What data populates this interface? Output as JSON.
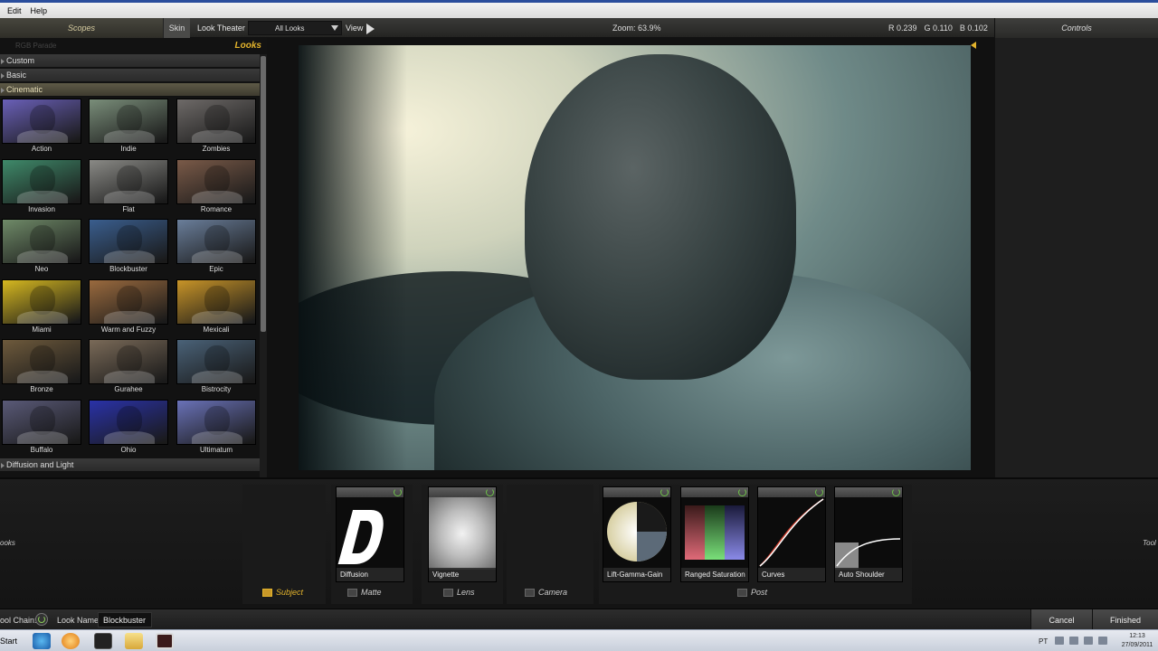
{
  "menu": {
    "edit": "Edit",
    "help": "Help"
  },
  "topbar": {
    "scopes": "Scopes",
    "skin": "Skin",
    "look_theater": "Look Theater",
    "look_filter": "All Looks",
    "view": "View",
    "zoom": "Zoom:  63.9%",
    "r": "R 0.239",
    "g": "G 0.110",
    "b": "B 0.102",
    "controls": "Controls"
  },
  "looks_panel": {
    "ghost_label": "RGB Parade",
    "title": "Looks",
    "categories": [
      "Custom",
      "Basic",
      "Cinematic"
    ],
    "bottom_category": "Diffusion and Light",
    "thumbnails": [
      {
        "label": "Action",
        "tint": "#6a60b8"
      },
      {
        "label": "Indie",
        "tint": "#7a8e7a"
      },
      {
        "label": "Zombies",
        "tint": "#6e6a68"
      },
      {
        "label": "Invasion",
        "tint": "#3f8a6a"
      },
      {
        "label": "Flat",
        "tint": "#8a8a86"
      },
      {
        "label": "Romance",
        "tint": "#7a5a48"
      },
      {
        "label": "Neo",
        "tint": "#6f8a68"
      },
      {
        "label": "Blockbuster",
        "tint": "#3a5e8e"
      },
      {
        "label": "Epic",
        "tint": "#6a7e9a"
      },
      {
        "label": "Miami",
        "tint": "#d6b820"
      },
      {
        "label": "Warm and Fuzzy",
        "tint": "#9a6a3e"
      },
      {
        "label": "Mexicali",
        "tint": "#c89428"
      },
      {
        "label": "Bronze",
        "tint": "#6e5a3c"
      },
      {
        "label": "Gurahee",
        "tint": "#7a6a58"
      },
      {
        "label": "Bistrocity",
        "tint": "#4a6278"
      },
      {
        "label": "Buffalo",
        "tint": "#5a5a78"
      },
      {
        "label": "Ohio",
        "tint": "#2a32a8"
      },
      {
        "label": "Ultimatum",
        "tint": "#6a72b8"
      }
    ]
  },
  "tools": {
    "side_left": "ooks",
    "side_right": "Tool",
    "items": [
      {
        "name": "Diffusion"
      },
      {
        "name": "Vignette"
      },
      {
        "name": "Lift-Gamma-Gain"
      },
      {
        "name": "Ranged Saturation"
      },
      {
        "name": "Curves"
      },
      {
        "name": "Auto Shoulder"
      }
    ],
    "sections": [
      "Subject",
      "Matte",
      "Lens",
      "Camera",
      "Post"
    ]
  },
  "footer": {
    "tool_chain": "ool Chain:",
    "look_name_label": "Look Name:",
    "look_name_value": "Blockbuster",
    "cancel": "Cancel",
    "finished": "Finished"
  },
  "taskbar": {
    "start": "Start",
    "lang": "PT",
    "time": "12:13",
    "date": "27/09/2011"
  },
  "colors": {
    "accent": "#e3b32c",
    "power_green": "#6ec04a"
  }
}
